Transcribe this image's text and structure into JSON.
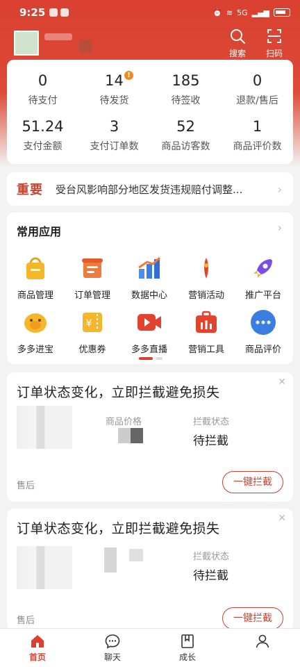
{
  "status_bar": {
    "time": "9:25",
    "network": "5G"
  },
  "header": {
    "search_label": "搜索",
    "scan_label": "扫码"
  },
  "stats": [
    {
      "value": "0",
      "label": "待支付"
    },
    {
      "value": "14",
      "label": "待发货",
      "badge": "!"
    },
    {
      "value": "185",
      "label": "待签收"
    },
    {
      "value": "0",
      "label": "退款/售后"
    },
    {
      "value": "51.24",
      "label": "支付金额"
    },
    {
      "value": "3",
      "label": "支付订单数"
    },
    {
      "value": "52",
      "label": "商品访客数"
    },
    {
      "value": "1",
      "label": "商品评价数"
    }
  ],
  "notice": {
    "tag": "重要",
    "text": "受台风影响部分地区发货违规赔付调整..."
  },
  "apps": {
    "title": "常用应用",
    "items": [
      {
        "label": "商品管理",
        "icon": "shopping-bag-icon"
      },
      {
        "label": "订单管理",
        "icon": "order-scroll-icon"
      },
      {
        "label": "数据中心",
        "icon": "bar-chart-icon"
      },
      {
        "label": "营销活动",
        "icon": "marketing-pin-icon"
      },
      {
        "label": "推广平台",
        "icon": "rocket-icon"
      },
      {
        "label": "多多进宝",
        "icon": "money-pig-icon"
      },
      {
        "label": "优惠券",
        "icon": "coupon-icon"
      },
      {
        "label": "多多直播",
        "icon": "live-video-icon"
      },
      {
        "label": "营销工具",
        "icon": "toolbox-icon"
      },
      {
        "label": "商品评价",
        "icon": "comment-icon"
      }
    ]
  },
  "orders": [
    {
      "title": "订单状态变化，立即拦截避免损失",
      "field1_label": "商品价格",
      "field2_label": "拦截状态",
      "field2_value": "待拦截",
      "footer_label": "售后",
      "button_label": "一键拦截"
    },
    {
      "title": "订单状态变化，立即拦截避免损失",
      "field2_label": "拦截状态",
      "field2_value": "待拦截",
      "footer_label": "售后",
      "button_label": "一键拦截"
    }
  ],
  "tabbar": [
    {
      "label": "首页",
      "active": true
    },
    {
      "label": "聊天"
    },
    {
      "label": "成长"
    },
    {
      "label": ""
    }
  ],
  "colors": {
    "brand": "#d9402f",
    "badge": "#f08a24"
  }
}
